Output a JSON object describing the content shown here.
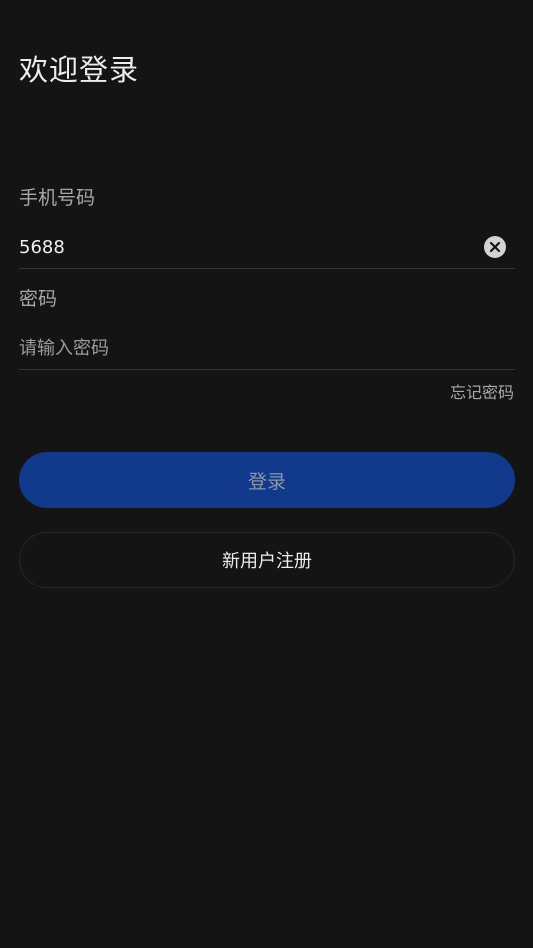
{
  "header": {
    "title": "欢迎登录"
  },
  "form": {
    "phone": {
      "label": "手机号码",
      "value": "5688",
      "placeholder": ""
    },
    "password": {
      "label": "密码",
      "value": "",
      "placeholder": "请输入密码"
    },
    "forgot_label": "忘记密码"
  },
  "actions": {
    "login_label": "登录",
    "register_label": "新用户注册"
  },
  "colors": {
    "background": "#141414",
    "primary_button": "#113a8c",
    "primary_button_text": "#8c96aa",
    "divider": "#343434"
  }
}
